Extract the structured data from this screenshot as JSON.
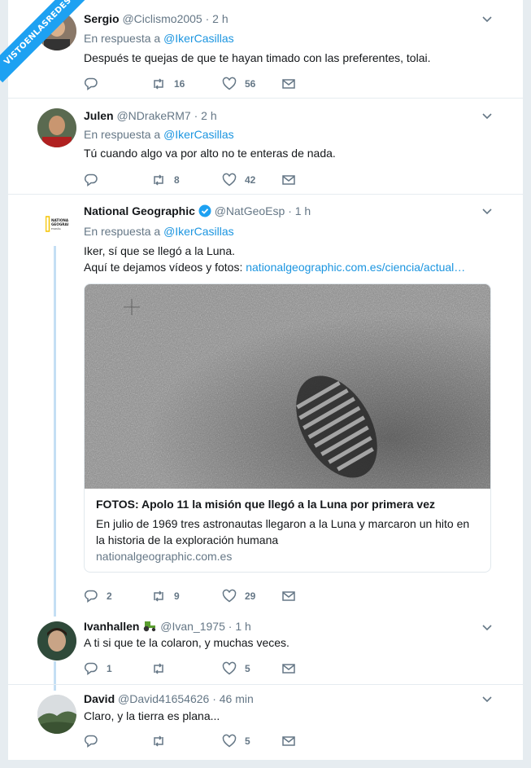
{
  "watermark": "VISTOENLASREDES",
  "tweets": [
    {
      "name": "Sergio",
      "handle": "@Ciclismo2005",
      "time": "2 h",
      "reply_prefix": "En respuesta a",
      "reply_to": "@IkerCasillas",
      "text": "Después te quejas de que te hayan timado con las preferentes, tolai.",
      "retweets": "16",
      "likes": "56",
      "replies": ""
    },
    {
      "name": "Julen",
      "handle": "@NDrakeRM7",
      "time": "2 h",
      "reply_prefix": "En respuesta a",
      "reply_to": "@IkerCasillas",
      "text": "Tú cuando algo va por alto no te enteras de nada.",
      "retweets": "8",
      "likes": "42",
      "replies": ""
    },
    {
      "name": "National Geographic",
      "handle": "@NatGeoEsp",
      "time": "1 h",
      "reply_prefix": "En respuesta a",
      "reply_to": "@IkerCasillas",
      "text_line1": "Iker, sí que se llegó a la Luna.",
      "text_line2_prefix": "Aquí te dejamos vídeos y fotos:",
      "text_link": "nationalgeographic.com.es/ciencia/actual…",
      "logo_text": "NATIONAL GEOGRAPHIC ESPAÑA",
      "card_title": "FOTOS: Apolo 11 la misión que llegó a la Luna por primera vez",
      "card_desc": "En julio de 1969 tres astronautas llegaron a la Luna y marcaron un hito en la historia de la exploración humana",
      "card_domain": "nationalgeographic.com.es",
      "replies": "2",
      "retweets": "9",
      "likes": "29"
    },
    {
      "name": "Ivanhallen",
      "handle": "@Ivan_1975",
      "time": "1 h",
      "text": "A ti si que te la colaron, y muchas veces.",
      "replies": "1",
      "retweets": "",
      "likes": "5"
    },
    {
      "name": "David",
      "handle": "@David41654626",
      "time": "46 min",
      "text": "Claro, y la tierra es plana...",
      "replies": "",
      "retweets": "",
      "likes": "5"
    }
  ],
  "colors": {
    "link": "#1b95e0",
    "muted": "#657786",
    "verified": "#1da1f2",
    "thread": "#c4dff4"
  }
}
